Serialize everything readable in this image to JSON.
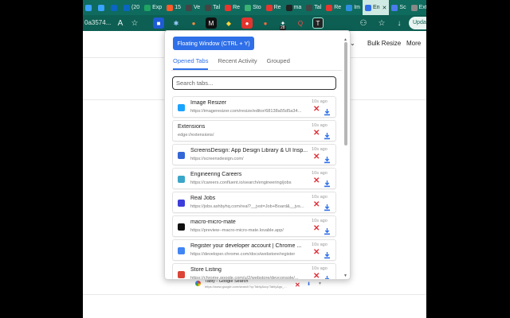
{
  "browser": {
    "tabs": [
      {
        "label": "",
        "fav_color": "#3aa3ff"
      },
      {
        "label": "",
        "fav_color": "#3aa3ff"
      },
      {
        "label": "",
        "fav_color": "#0a66c2"
      },
      {
        "label": "(20",
        "fav_color": "#0a66c2"
      },
      {
        "label": "Exp",
        "fav_color": "#1fa463"
      },
      {
        "label": "15",
        "fav_color": "#ff5a2a"
      },
      {
        "label": "Ve",
        "fav_color": "#444444"
      },
      {
        "label": "Tal",
        "fav_color": "#444444"
      },
      {
        "label": "Re",
        "fav_color": "#e9352f"
      },
      {
        "label": "Sto",
        "fav_color": "#3bb273"
      },
      {
        "label": "Re",
        "fav_color": "#e9352f"
      },
      {
        "label": "ma",
        "fav_color": "#222222"
      },
      {
        "label": "Tal",
        "fav_color": "#444444"
      },
      {
        "label": "Re",
        "fav_color": "#e9352f"
      },
      {
        "label": "Im",
        "fav_color": "#2d8fe0"
      },
      {
        "label": "En",
        "fav_color": "#2f6fe8",
        "active": true
      },
      {
        "label": "Sc",
        "fav_color": "#4b7bec"
      },
      {
        "label": "Ext",
        "fav_color": "#888888"
      }
    ],
    "omnibox_text": "0a3574...",
    "update_label": "Upda",
    "ext_badge": "28"
  },
  "page": {
    "bulk_resize_label": "Bulk Resize",
    "more_label": "More"
  },
  "popup": {
    "floating_window_label": "Floating Window (CTRL + Y)",
    "nav_tabs": [
      "Opened Tabs",
      "Recent Activity",
      "Grouped"
    ],
    "search_placeholder": "Search tabs...",
    "tabs": [
      {
        "title": "Image Resizer",
        "url": "https://imageresizer.com/resize/editor/68138a55d5a34...",
        "ago": "10s ago",
        "icon_color": "#1aa3ff",
        "icon": "image-resizer-icon"
      },
      {
        "title": "Extensions",
        "url": "edge://extensions/",
        "ago": "10s ago",
        "icon_color": "",
        "icon": ""
      },
      {
        "title": "ScreensDesign: App Design Library & UI Insp...",
        "url": "https://screensdesign.com/",
        "ago": "10s ago",
        "icon_color": "#3367d6",
        "icon": "screensdesign-icon"
      },
      {
        "title": "Engineering Careers",
        "url": "https://careers.confluent.io/search/engineering/jobs",
        "ago": "10s ago",
        "icon_color": "#3aa6c9",
        "icon": "confluent-icon"
      },
      {
        "title": "Real Jobs",
        "url": "https://jobs.ashbyhq.com/real?__jvst=Job+Board&__jvs...",
        "ago": "10s ago",
        "icon_color": "#3d3ddb",
        "icon": "ashby-icon"
      },
      {
        "title": "macro-micro-mate",
        "url": "https://preview--macro-micro-mate.lovable.app/",
        "ago": "10s ago",
        "icon_color": "#111111",
        "icon": "lovable-icon"
      },
      {
        "title": "Register your developer account | Chrome ...",
        "url": "https://developer.chrome.com/docs/webstore/register",
        "ago": "10s ago",
        "icon_color": "#4285f4",
        "icon": "chrome-icon"
      },
      {
        "title": "Store Listing",
        "url": "https://chrome.google.com/u/2/webstore/devconsole/...",
        "ago": "10s ago",
        "icon_color": "#db4437",
        "icon": "webstore-icon"
      }
    ]
  },
  "ghost_row": {
    "title": "Tably - Google Search",
    "url": "https://www.google.com/search?q=Tably&oq=Tably&gs_..."
  },
  "colors": {
    "tabstrip": "#0f6b5e",
    "accent": "#2f6fe8",
    "close_red": "#e0303a"
  }
}
